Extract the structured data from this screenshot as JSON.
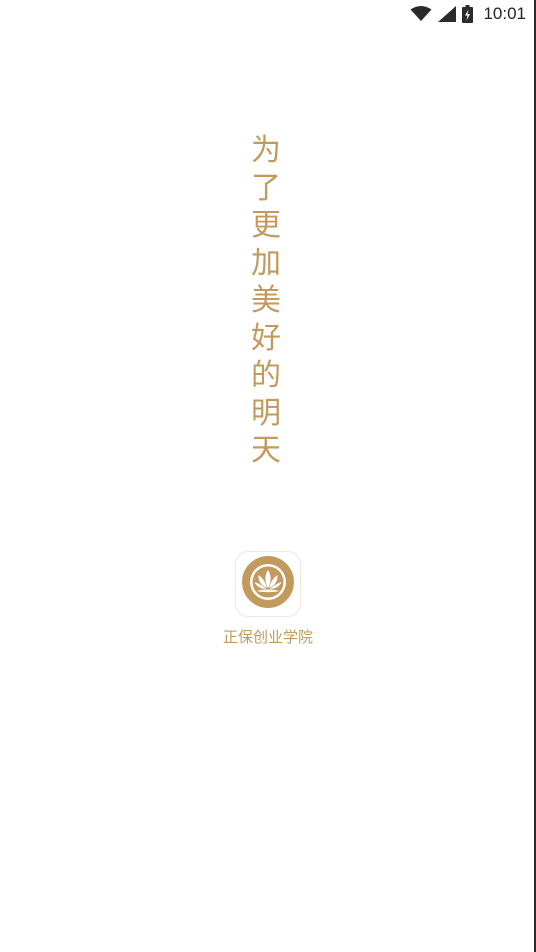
{
  "status_bar": {
    "time": "10:01",
    "icons": [
      "wifi-icon",
      "cellular-signal-icon",
      "battery-charging-icon"
    ]
  },
  "slogan": {
    "chars": [
      "为",
      "了",
      "更",
      "加",
      "美",
      "好",
      "的",
      "明",
      "天"
    ]
  },
  "app": {
    "icon": "lotus-logo-icon",
    "name": "正保创业学院"
  },
  "colors": {
    "accent": "#c39a5e",
    "background": "#ffffff",
    "status_text": "#222222"
  }
}
